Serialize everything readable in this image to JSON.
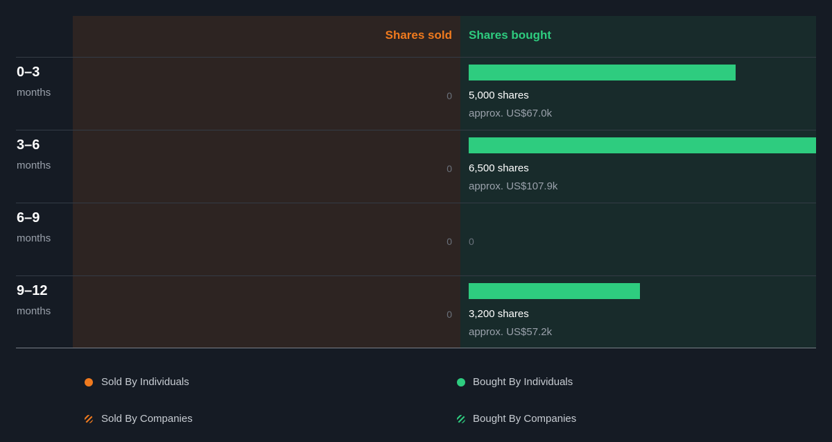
{
  "chart_data": {
    "type": "bar",
    "orientation": "horizontal",
    "headers": {
      "sold": "Shares sold",
      "bought": "Shares bought"
    },
    "categories": [
      {
        "period": "0–3",
        "unit": "months"
      },
      {
        "period": "3–6",
        "unit": "months"
      },
      {
        "period": "6–9",
        "unit": "months"
      },
      {
        "period": "9–12",
        "unit": "months"
      }
    ],
    "sold": [
      {
        "label": "0"
      },
      {
        "label": "0"
      },
      {
        "label": "0"
      },
      {
        "label": "0"
      }
    ],
    "bought": [
      {
        "value": 5000,
        "shares_label": "5,000 shares",
        "approx_label": "approx. US$67.0k"
      },
      {
        "value": 6500,
        "shares_label": "6,500 shares",
        "approx_label": "approx. US$107.9k"
      },
      {
        "value": 0,
        "shares_label": "",
        "approx_label": "",
        "zero_label": "0"
      },
      {
        "value": 3200,
        "shares_label": "3,200 shares",
        "approx_label": "approx. US$57.2k"
      }
    ],
    "xlim": [
      0,
      6500
    ],
    "legend": [
      {
        "label": "Sold By Individuals",
        "color": "#f07a1e",
        "marker": "dot"
      },
      {
        "label": "Bought By Individuals",
        "color": "#2ecc7f",
        "marker": "dot"
      },
      {
        "label": "Sold By Companies",
        "color": "#f07a1e",
        "marker": "hatch"
      },
      {
        "label": "Bought By Companies",
        "color": "#2ecc7f",
        "marker": "hatch"
      }
    ],
    "colors": {
      "sold": "#f07a1e",
      "bought": "#2ecc7f",
      "background": "#151b24"
    }
  }
}
